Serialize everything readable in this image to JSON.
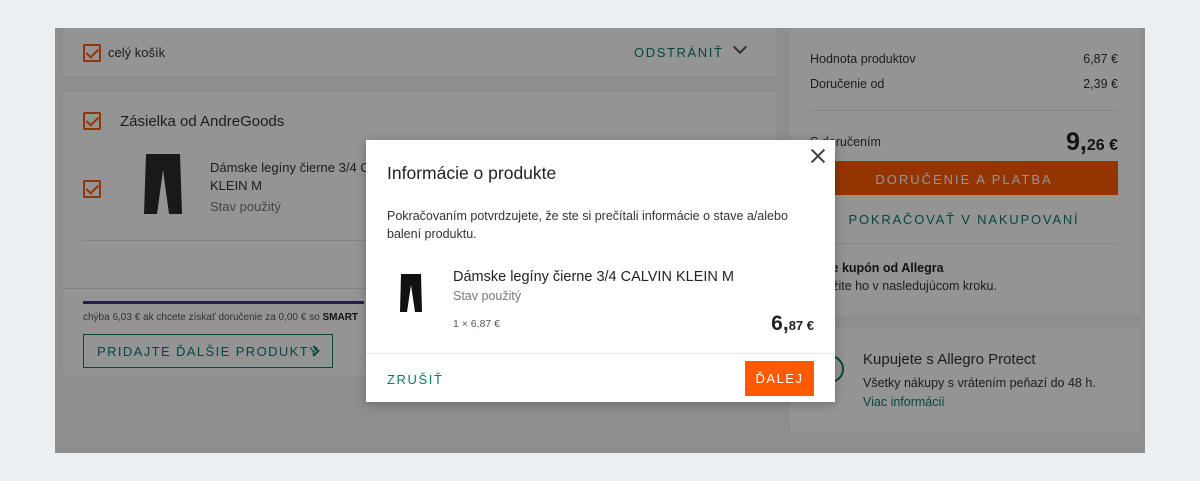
{
  "cart": {
    "select_all_label": "celý košík",
    "remove_label": "ODSTRÁNIŤ",
    "seller_label": "Zásielka od AndreGoods",
    "product_name": "Dámske legíny čierne 3/4 CALVIN KLEIN M",
    "product_state": "Stav použitý",
    "shipping_prefix": "chýba 6,03 € ak chcete získať doručenie za 0,00 € so",
    "shipping_brand": "SMART",
    "add_more_label": "PRIDAJTE ĎALŠIE PRODUKTY",
    "shipping_progress": 0.53
  },
  "summary": {
    "products_label": "Hodnota produktov",
    "products_value": "6,87 €",
    "delivery_label": "Doručenie od",
    "delivery_value": "2,39 €",
    "total_label": "S doručením",
    "total_int": "9,",
    "total_dec": "26 €",
    "pay_button": "DORUČENIE A PLATBA",
    "continue_label": "POKRAČOVAŤ V NAKUPOVANÍ",
    "coupon_title": "Máte kupón od Allegra",
    "coupon_text": "Použite ho v nasledujúcom kroku."
  },
  "protect": {
    "title": "Kupujete s Allegro Protect",
    "text": "Všetky nákupy s vrátením peňazí do 48 h.",
    "link": "Viac informácií"
  },
  "modal": {
    "title": "Informácie o produkte",
    "description": "Pokračovaním potvrdzujete, že ste si prečítali informácie o stave a/alebo balení produktu.",
    "product_name": "Dámske legíny čierne 3/4 CALVIN KLEIN M",
    "product_state": "Stav použitý",
    "quantity": "1 × 6,87 €",
    "price_int": "6,",
    "price_dec": "87 €",
    "cancel_label": "ZRUŠIŤ",
    "next_label": "ĎALEJ"
  },
  "colors": {
    "accent": "#ff5a00",
    "link": "#0b7a6e",
    "smart_bar": "#4a2f8a"
  }
}
